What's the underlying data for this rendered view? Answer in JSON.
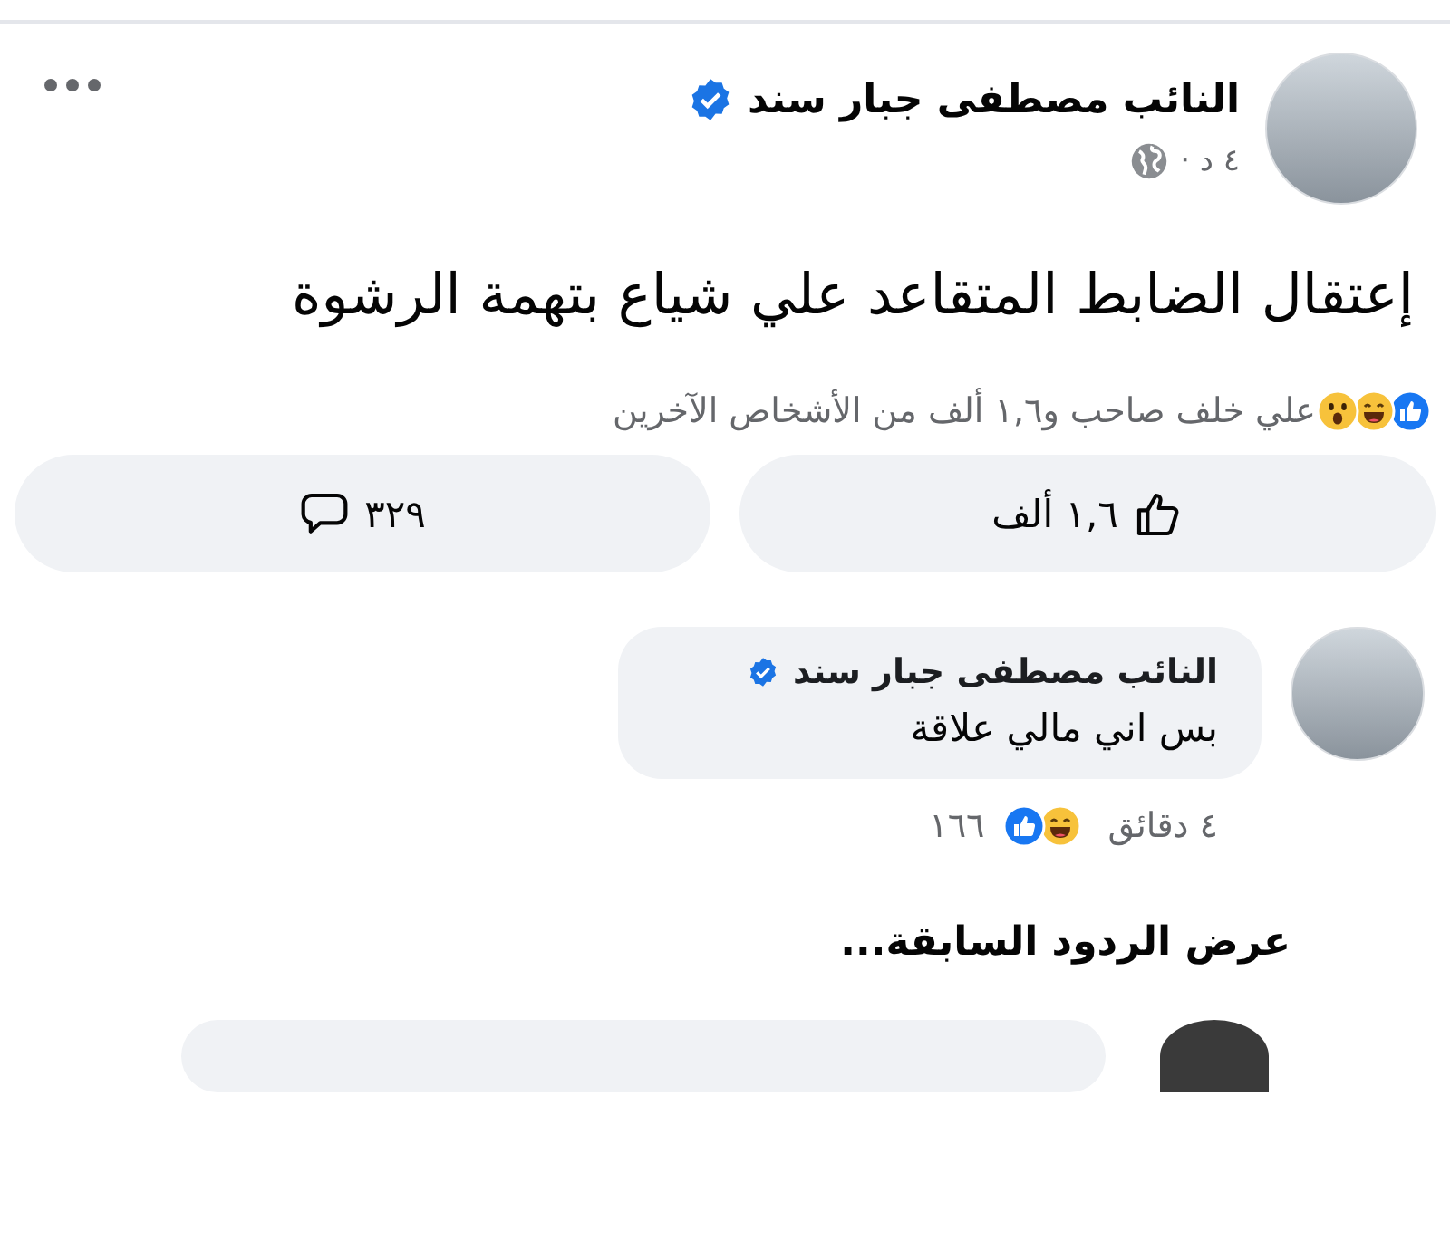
{
  "post": {
    "author": {
      "name": "النائب مصطفى جبار سند",
      "verified": true
    },
    "time": "٤ د ·",
    "text": "إعتقال الضابط المتقاعد علي شياع بتهمة الرشوة",
    "reactions": [
      {
        "kind": "like"
      },
      {
        "kind": "haha"
      },
      {
        "kind": "wow"
      }
    ],
    "reactions_summary": "علي خلف صاحب و١,٦ ألف من الأشخاص الآخرين",
    "like_button": "١,٦ ألف",
    "comment_button": "٣٢٩"
  },
  "comments": [
    {
      "author": {
        "name": "النائب مصطفى جبار سند",
        "verified": true
      },
      "text": "بس اني مالي علاقة",
      "time": "٤ دقائق",
      "reactions": [
        {
          "kind": "haha"
        },
        {
          "kind": "like"
        }
      ],
      "reaction_count": "١٦٦"
    }
  ],
  "view_previous_replies": "عرض الردود السابقة..."
}
